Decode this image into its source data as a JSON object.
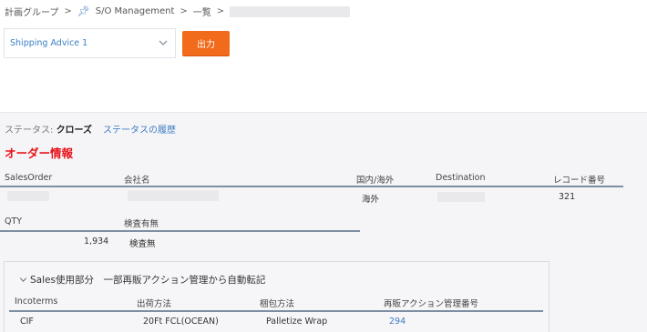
{
  "breadcrumb": {
    "group": "計画グループ",
    "separator": ">",
    "management": "S/O Management",
    "list": "一覧"
  },
  "selector": {
    "value": "Shipping Advice 1"
  },
  "output_button": {
    "label": "出力"
  },
  "status": {
    "label": "ステータス:",
    "value": "クローズ",
    "history_link": "ステータスの履歴"
  },
  "order_info": {
    "title": "オーダー情報",
    "headers": {
      "sales_order": "SalesOrder",
      "company": "会社名",
      "domestic_overseas": "国内/海外",
      "destination": "Destination",
      "record_no": "レコード番号",
      "qty": "QTY",
      "inspection": "検査有無"
    },
    "values": {
      "domestic_overseas": "海外",
      "record_no": "321",
      "qty": "1,934",
      "inspection": "検査無"
    }
  },
  "sales_section": {
    "title": "Sales使用部分　一部再販アクション管理から自動転記",
    "headers": {
      "incoterms": "Incoterms",
      "shipping_method": "出荷方法",
      "packing_method": "梱包方法",
      "resale_action_no": "再販アクション管理番号"
    },
    "values": {
      "incoterms": "CIF",
      "shipping_method": "20Ft FCL(OCEAN)",
      "packing_method": "Palletize Wrap",
      "resale_action_no": "294"
    }
  },
  "colors": {
    "accent": "#f26a1b",
    "link": "#3e7bc4",
    "title_red": "#e8131a"
  }
}
